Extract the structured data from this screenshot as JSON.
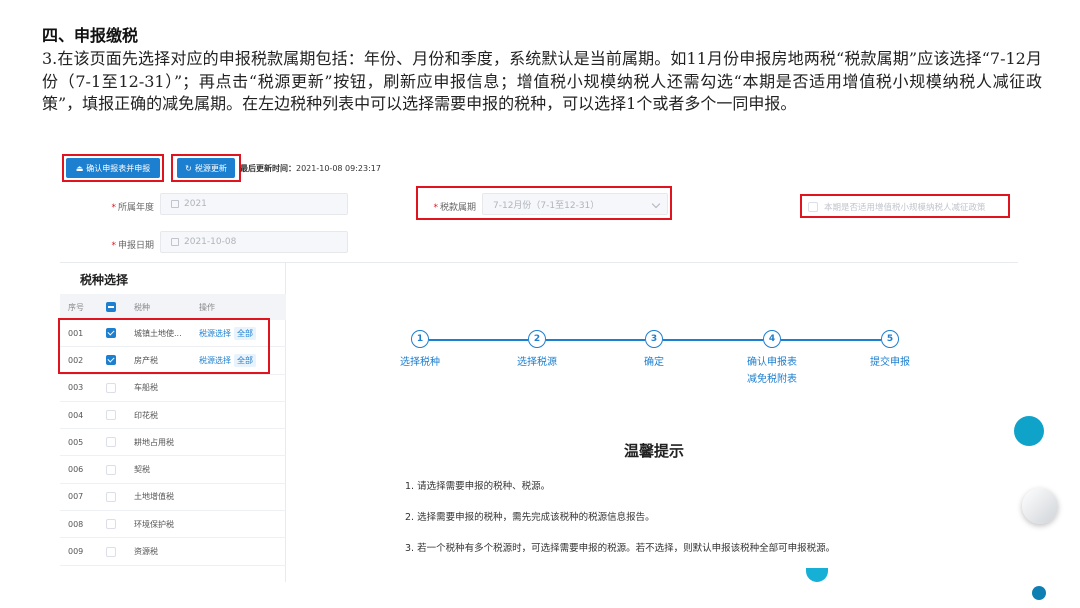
{
  "doc": {
    "heading": "四、申报缴税",
    "paragraph": "3.在该页面先选择对应的申报税款属期包括：年份、月份和季度，系统默认是当前属期。如11月份申报房地两税“税款属期”应该选择“7-12月份（7-1至12-31）”；再点击“税源更新”按钮，刷新应申报信息；增值税小规模纳税人还需勾选“本期是否适用增值税小规模纳税人减征政策”，填报正确的减免属期。在左边税种列表中可以选择需要申报的税种，可以选择1个或者多个一同申报。"
  },
  "toolbar": {
    "confirm_label": "确认申报表并申报",
    "refresh_label": "税源更新",
    "update_prefix": "最后更新时间：",
    "update_time": "2021-10-08 09:23:17"
  },
  "form": {
    "year_label": "所属年度",
    "year_value": "2021",
    "date_label": "申报日期",
    "date_value": "2021-10-08",
    "period_label": "税款属期",
    "period_value": "7-12月份（7-1至12-31）",
    "policy_label": "本期是否适用增值税小规模纳税人减征政策"
  },
  "tax_panel": {
    "title": "税种选择",
    "headers": {
      "no": "序号",
      "name": "税种",
      "op": "操作"
    },
    "op_select": "税源选择",
    "op_all": "全部",
    "rows": [
      {
        "no": "001",
        "name": "城镇土地使...",
        "checked": true
      },
      {
        "no": "002",
        "name": "房产税",
        "checked": true
      },
      {
        "no": "003",
        "name": "车船税",
        "checked": false
      },
      {
        "no": "004",
        "name": "印花税",
        "checked": false
      },
      {
        "no": "005",
        "name": "耕地占用税",
        "checked": false
      },
      {
        "no": "006",
        "name": "契税",
        "checked": false
      },
      {
        "no": "007",
        "name": "土地增值税",
        "checked": false
      },
      {
        "no": "008",
        "name": "环境保护税",
        "checked": false
      },
      {
        "no": "009",
        "name": "资源税",
        "checked": false
      }
    ]
  },
  "steps": [
    {
      "num": "1",
      "label": "选择税种"
    },
    {
      "num": "2",
      "label": "选择税源"
    },
    {
      "num": "3",
      "label": "确定"
    },
    {
      "num": "4",
      "label": "确认申报表",
      "sub": "减免税附表"
    },
    {
      "num": "5",
      "label": "提交申报"
    }
  ],
  "tips": {
    "title": "温馨提示",
    "lines": [
      "1. 请选择需要申报的税种、税源。",
      "2. 选择需要申报的税种，需先完成该税种的税源信息报告。",
      "3. 若一个税种有多个税源时，可选择需要申报的税源。若不选择，则默认申报该税种全部可申报税源。"
    ]
  },
  "colors": {
    "primary": "#1d7fcf",
    "highlight": "#e0141e"
  }
}
